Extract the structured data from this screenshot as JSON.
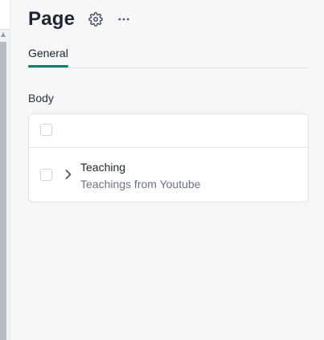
{
  "page": {
    "title": "Page"
  },
  "tabs": [
    {
      "label": "General",
      "active": true
    }
  ],
  "section": {
    "label": "Body"
  },
  "list": {
    "items": [
      {
        "title": "Teaching",
        "subtitle": "Teachings from Youtube"
      }
    ]
  },
  "colors": {
    "accent": "#137a6d",
    "background": "#f6f7f9",
    "card": "#ffffff",
    "text": "#1f2430",
    "muted_text": "#6b7280"
  },
  "icons": {
    "settings": "gear-icon",
    "more": "more-horizontal-icon",
    "expand": "chevron-right-icon",
    "scroll_up": "scroll-up-arrow-icon"
  }
}
